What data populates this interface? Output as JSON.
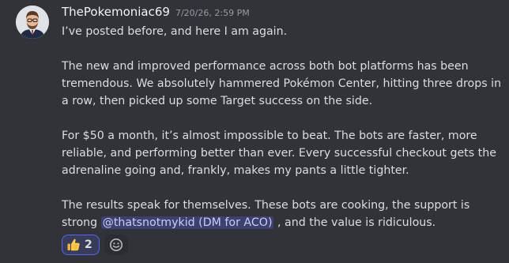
{
  "message": {
    "username": "ThePokemoniac69",
    "timestamp": "7/20/26, 2:59 PM",
    "paragraphs": [
      "I’ve posted before, and here I am again.",
      "The new and improved performance across both bot platforms has been tremendous. We absolutely hammered Pokémon Center, hitting three drops in a row, then picked up some Target success on the side.",
      "For $50 a month, it’s almost impossible to beat. The bots are faster, more reliable, and performing better than ever. Every successful checkout gets the adrenaline going and, frankly, makes my pants a little tighter."
    ],
    "final_paragraph": {
      "before_mention": "The results speak for themselves. These bots are cooking, the support is strong ",
      "mention": "@thatsnotmykid (DM for ACO)",
      "after_mention": " , and the value is ridiculous."
    }
  },
  "reactions": [
    {
      "emoji": "thumbs-up-icon",
      "count": "2"
    }
  ],
  "add_reaction": {
    "icon": "add-reaction-smiley-icon"
  },
  "colors": {
    "background": "#313338",
    "text": "#dbdee1",
    "timestamp": "#949ba4",
    "mention_bg": "rgba(88, 101, 242, 0.3)",
    "reaction_border": "#5865f2"
  }
}
